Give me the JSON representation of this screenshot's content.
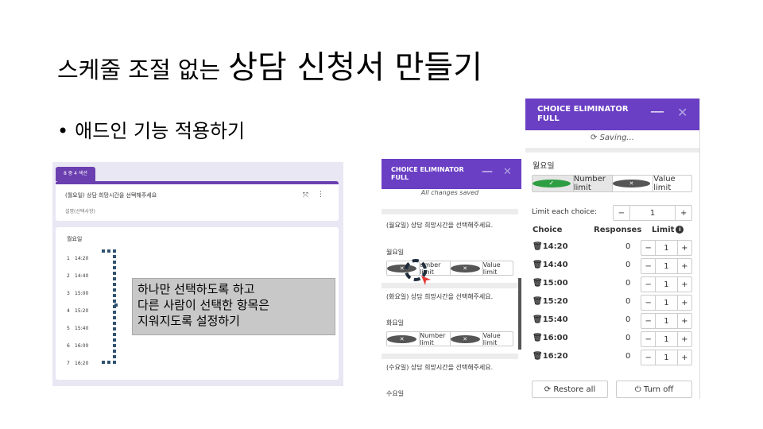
{
  "title": {
    "part1": "스케줄 조절 없는",
    "part2": "상담 신청서 만들기"
  },
  "bullet": {
    "dot": "•",
    "text": "애드인 기능 적용하기"
  },
  "gform": {
    "tab": "8 중 4 섹션",
    "question": "(월요일) 상담 희망시간을 선택해주세요",
    "description": "설명(선택사항)",
    "day": "월요일",
    "options": [
      {
        "n": "1",
        "time": "14:20"
      },
      {
        "n": "2",
        "time": "14:40"
      },
      {
        "n": "3",
        "time": "15:00"
      },
      {
        "n": "4",
        "time": "15:20"
      },
      {
        "n": "5",
        "time": "15:40"
      },
      {
        "n": "6",
        "time": "16:00"
      },
      {
        "n": "7",
        "time": "16:20"
      }
    ]
  },
  "callout": {
    "lines": [
      "하나만 선택하도록 하고",
      "다른 사람이 선택한 항목은",
      "지워지도록 설정하기"
    ]
  },
  "mid_panel": {
    "title_line1": "CHOICE ELIMINATOR",
    "title_line2": "FULL",
    "minimize": "—",
    "close": "✕",
    "status": "All changes saved",
    "q_mon": "(월요일) 상담 희망시간을 선택해주세요.",
    "day_mon": "월요일",
    "number_limit_partial": "umber limit",
    "number_limit": "Number limit",
    "value_limit": "Value limit",
    "q_tue": "(화요일) 상담 희망시간을 선택해주세요.",
    "day_tue": "화요일",
    "q_wed": "(수요일) 상담 희망시간을 선택해주세요.",
    "day_wed": "수요일"
  },
  "right_panel": {
    "title_line1": "CHOICE ELIMINATOR",
    "title_line2": "FULL",
    "minimize": "—",
    "close": "✕",
    "status": "Saving...",
    "day": "월요일",
    "number_limit": "Number limit",
    "value_limit": "Value limit",
    "limit_each_label": "Limit each choice:",
    "limit_each_value": "1",
    "col_choice": "Choice",
    "col_responses": "Responses",
    "col_limit": "Limit",
    "rows": [
      {
        "choice": "14:20",
        "responses": "0",
        "limit": "1"
      },
      {
        "choice": "14:40",
        "responses": "0",
        "limit": "1"
      },
      {
        "choice": "15:00",
        "responses": "0",
        "limit": "1"
      },
      {
        "choice": "15:20",
        "responses": "0",
        "limit": "1"
      },
      {
        "choice": "15:40",
        "responses": "0",
        "limit": "1"
      },
      {
        "choice": "16:00",
        "responses": "0",
        "limit": "1"
      },
      {
        "choice": "16:20",
        "responses": "0",
        "limit": "1"
      }
    ],
    "restore_all": "Restore all",
    "turn_off": "Turn off"
  },
  "colors": {
    "accent": "#6a3fc4",
    "green": "#2e9e43",
    "bracket": "#2f5270",
    "pointer": "#e53935"
  }
}
